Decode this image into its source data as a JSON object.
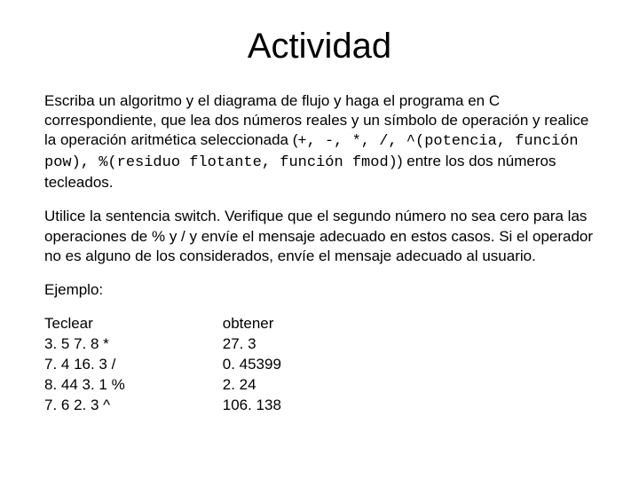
{
  "title": "Actividad",
  "p1_a": "Escriba un algoritmo y el diagrama de flujo y haga el programa en C correspondiente, que lea dos números reales y un símbolo de operación y realice la operación aritmética seleccionada (",
  "p1_ops": "+, -, *, /, ^(potencia, función pow), %(residuo flotante, función fmod)",
  "p1_b": ") entre los dos números tecleados.",
  "p2": "Utilice la sentencia switch. Verifique que el segundo número no sea cero para las operaciones de % y / y envíe el mensaje adecuado en estos casos. Si el operador no es alguno de los considerados, envíe el mensaje adecuado al usuario.",
  "example_label": "Ejemplo:",
  "teclear_label": "Teclear",
  "obtener_label": "obtener",
  "teclear_lines": "3. 5 7. 8 *\n7. 4 16. 3 /\n8. 44 3. 1 %\n7. 6 2. 3 ^",
  "obtener_lines": "27. 3\n0. 45399\n2. 24\n106. 138"
}
